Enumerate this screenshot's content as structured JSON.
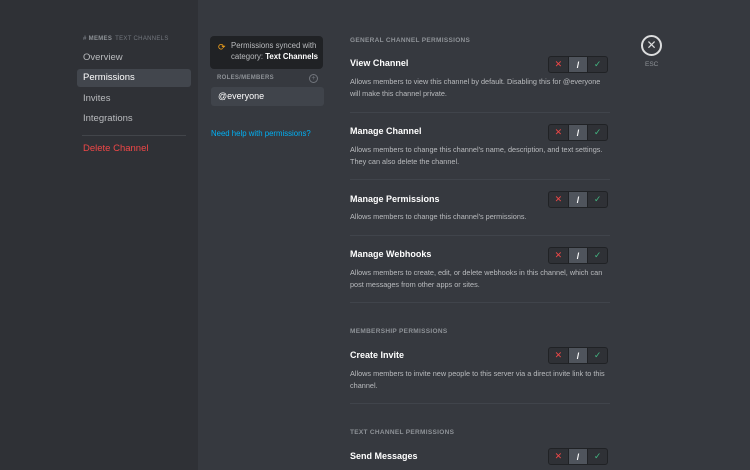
{
  "window": {
    "dots": [
      {
        "name": "close-dot",
        "color": "#ff5f57"
      },
      {
        "name": "minimize-dot",
        "color": "#febc2e"
      },
      {
        "name": "zoom-dot",
        "color": "#28c840"
      }
    ]
  },
  "sidebar": {
    "channel_hash": "#",
    "channel_name": "MEMES",
    "channel_category": "TEXT CHANNELS",
    "items": [
      {
        "label": "Overview"
      },
      {
        "label": "Permissions"
      },
      {
        "label": "Invites"
      },
      {
        "label": "Integrations"
      },
      {
        "label": "Delete Channel"
      }
    ]
  },
  "roles_panel": {
    "sync_text": "Permissions synced with category:",
    "sync_category": "Text Channels",
    "header": "ROLES/MEMBERS",
    "add_symbol": "+",
    "roles": [
      "@everyone"
    ],
    "help_link": "Need help with permissions?"
  },
  "sections": [
    {
      "title": "GENERAL CHANNEL PERMISSIONS",
      "permissions": [
        {
          "name": "View Channel",
          "description": "Allows members to view this channel by default. Disabling this for @everyone will make this channel private.",
          "state": "neutral"
        },
        {
          "name": "Manage Channel",
          "description": "Allows members to change this channel's name, description, and text settings. They can also delete the channel.",
          "state": "neutral"
        },
        {
          "name": "Manage Permissions",
          "description": "Allows members to change this channel's permissions.",
          "state": "neutral"
        },
        {
          "name": "Manage Webhooks",
          "description": "Allows members to create, edit, or delete webhooks in this channel, which can post messages from other apps or sites.",
          "state": "neutral"
        }
      ]
    },
    {
      "title": "MEMBERSHIP PERMISSIONS",
      "permissions": [
        {
          "name": "Create Invite",
          "description": "Allows members to invite new people to this server via a direct invite link to this channel.",
          "state": "neutral"
        }
      ]
    },
    {
      "title": "TEXT CHANNEL PERMISSIONS",
      "permissions": [
        {
          "name": "Send Messages",
          "description": "",
          "state": "neutral"
        }
      ]
    }
  ],
  "toggle": {
    "deny": "✕",
    "neutral": "/",
    "allow": "✓"
  },
  "close": {
    "symbol": "✕",
    "label": "ESC"
  },
  "colors": {
    "accent_red": "#f04747",
    "accent_green": "#43b581",
    "link": "#00b0f4",
    "sync_icon": "#faa61a"
  }
}
